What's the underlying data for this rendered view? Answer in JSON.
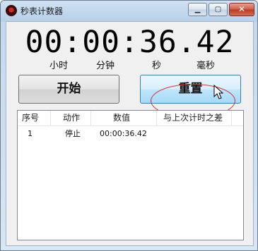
{
  "window": {
    "title": "秒表计数器"
  },
  "caption_buttons": {
    "min": "▁",
    "max": "▢",
    "close": "✕"
  },
  "display": {
    "time": "00:00:36.42"
  },
  "units": {
    "hour": "小时",
    "minute": "分钟",
    "second": "秒",
    "millisecond": "毫秒"
  },
  "buttons": {
    "start": "开始",
    "reset": "重置"
  },
  "list": {
    "columns": [
      "序号",
      "动作",
      "数值",
      "与上次计时之差"
    ],
    "rows": [
      {
        "index": "1",
        "action": "停止",
        "value": "00:00:36.42",
        "diff": ""
      }
    ]
  }
}
